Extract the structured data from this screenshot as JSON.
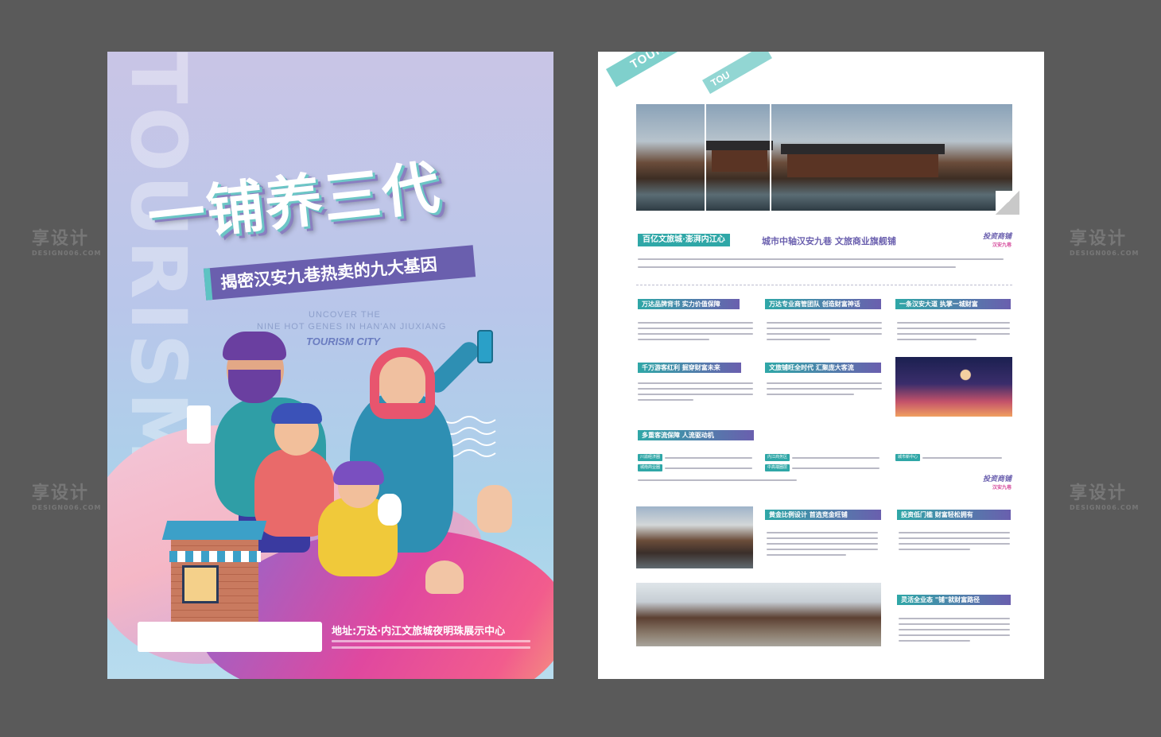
{
  "watermark": {
    "text": "享设计",
    "sub": "DESIGN006.COM"
  },
  "left_flyer": {
    "bg_word": "TOURISM",
    "headline": "一铺养三代",
    "subheadline": "揭密汉安九巷热卖的九大基因",
    "en_line1": "UNCOVER THE",
    "en_line2": "NINE HOT GENES IN HAN'AN JIUXIANG",
    "en_brand": "TOURISM CITY",
    "address": "地址:万达·内江文旅城夜明珠展示中心"
  },
  "right_flyer": {
    "ribbon": "TOURISM CITY",
    "ribbon2": "TOU",
    "intro_tag_a": "百亿文旅城",
    "intro_tag_dot": "·",
    "intro_tag_b": "澎湃内江心",
    "intro_title": "城市中轴汉安九巷 文旅商业旗舰铺",
    "logo_main": "投资商铺",
    "logo_sub": "汉安九巷",
    "sections": [
      {
        "label": "万达品牌背书 实力价值保障"
      },
      {
        "label": "万达专业商管团队 创造财富神话"
      },
      {
        "label": "一条汉安大道 执掌一城财富"
      },
      {
        "label": "千万游客红利 掘穿财富未来"
      },
      {
        "label": "文旅铺旺全时代 汇聚庞大客流"
      },
      {
        "label": "多重客流保障 人流驱动机"
      },
      {
        "label": "黄金比例设计 首选竞金旺铺"
      },
      {
        "label": "投资低门槛 财富轻松拥有"
      },
      {
        "label": "灵活全业态 \"铺\"就财富路径"
      }
    ],
    "mini_tags": [
      "川渝经济圈",
      "城南商业圈",
      "内江商务区",
      "中高端圈层",
      "城市新中心"
    ]
  }
}
